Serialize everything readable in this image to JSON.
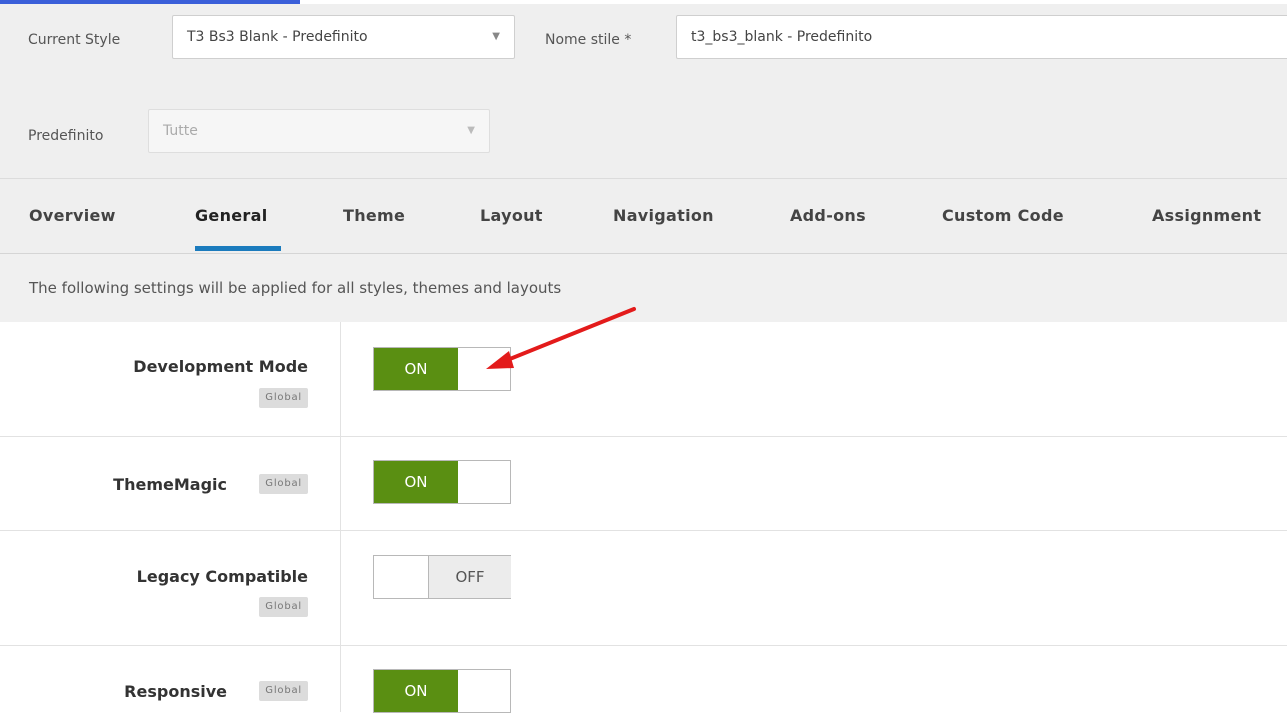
{
  "style_selector": {
    "current_style_label": "Current Style",
    "current_style_value": "T3 Bs3 Blank - Predefinito",
    "style_name_label": "Nome stile *",
    "style_name_value": "t3_bs3_blank - Predefinito",
    "default_label": "Predefinito",
    "default_value": "Tutte"
  },
  "tabs": [
    {
      "label": "Overview"
    },
    {
      "label": "General",
      "active": true
    },
    {
      "label": "Theme"
    },
    {
      "label": "Layout"
    },
    {
      "label": "Navigation"
    },
    {
      "label": "Add-ons"
    },
    {
      "label": "Custom Code"
    },
    {
      "label": "Assignment"
    }
  ],
  "info_text": "The following settings will be applied for all styles, themes and layouts",
  "settings": [
    {
      "label": "Development Mode",
      "badge": "Global",
      "state": "ON"
    },
    {
      "label": "ThemeMagic",
      "badge": "Global",
      "state": "ON"
    },
    {
      "label": "Legacy Compatible",
      "badge": "Global",
      "state": "OFF"
    },
    {
      "label": "Responsive",
      "badge": "Global",
      "state": "ON"
    }
  ],
  "colors": {
    "toggle_on": "#5a8f12",
    "active_tab_underline": "#1b7bbd",
    "annotation_arrow": "#e31b1b"
  }
}
